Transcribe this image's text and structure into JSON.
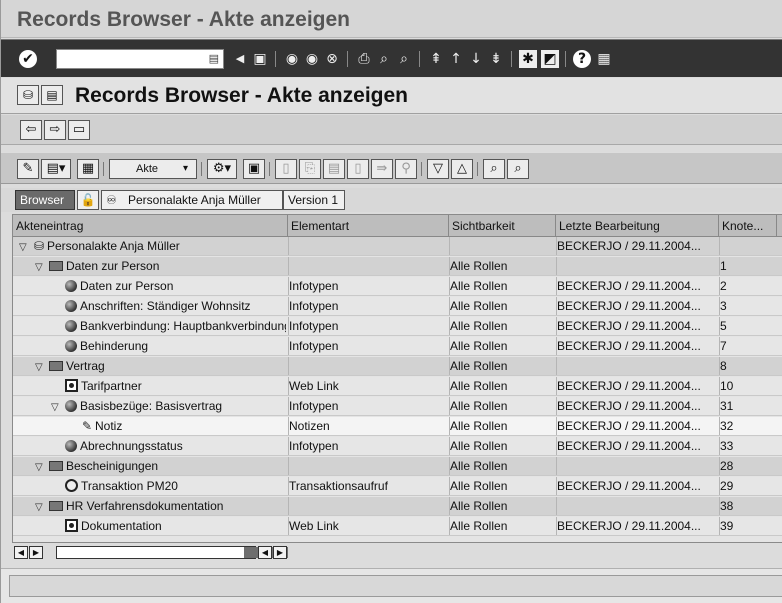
{
  "window": {
    "title": "Records Browser - Akte anzeigen"
  },
  "command_bar": {
    "command_field_value": "",
    "icons": [
      "enter-check",
      "save",
      "back",
      "exit",
      "cancel",
      "print",
      "find",
      "find-next",
      "first-page",
      "prev-page",
      "next-page",
      "last-page",
      "create-session",
      "generate-shortcut",
      "help",
      "layout-menu"
    ]
  },
  "header": {
    "title": "Records Browser - Akte anzeigen"
  },
  "nav_toolbar": {
    "icons": [
      "back-arrow",
      "forward-arrow",
      "overview"
    ]
  },
  "main_toolbar": {
    "akte_label": "Akte"
  },
  "breadcrumb": {
    "items": [
      "Browser",
      "Personalakte Anja Müller",
      "Version 1"
    ]
  },
  "table": {
    "columns": [
      "Akteneintrag",
      "Elementart",
      "Sichtbarkeit",
      "Letzte Bearbeitung",
      "Knote..."
    ],
    "rows": [
      {
        "name": "Personalakte Anja Müller",
        "type": "",
        "visibility": "",
        "last_edit": "BECKERJO / 29.11.2004...",
        "node": "",
        "level": 0,
        "expanded": true,
        "icon": "record",
        "kind": "folder"
      },
      {
        "name": "Daten zur Person",
        "type": "",
        "visibility": "Alle Rollen",
        "last_edit": "",
        "node": "1",
        "level": 1,
        "expanded": true,
        "icon": "folder",
        "kind": "folder"
      },
      {
        "name": "Daten zur Person",
        "type": "Infotypen",
        "visibility": "Alle Rollen",
        "last_edit": "BECKERJO / 29.11.2004...",
        "node": "2",
        "level": 2,
        "icon": "ball",
        "kind": "item"
      },
      {
        "name": "Anschriften: Ständiger Wohnsitz",
        "type": "Infotypen",
        "visibility": "Alle Rollen",
        "last_edit": "BECKERJO / 29.11.2004...",
        "node": "3",
        "level": 2,
        "icon": "ball",
        "kind": "item"
      },
      {
        "name": "Bankverbindung: Hauptbankverbindung",
        "type": "Infotypen",
        "visibility": "Alle Rollen",
        "last_edit": "BECKERJO / 29.11.2004...",
        "node": "5",
        "level": 2,
        "icon": "ball",
        "kind": "item"
      },
      {
        "name": "Behinderung",
        "type": "Infotypen",
        "visibility": "Alle Rollen",
        "last_edit": "BECKERJO / 29.11.2004...",
        "node": "7",
        "level": 2,
        "icon": "ball",
        "kind": "item"
      },
      {
        "name": "Vertrag",
        "type": "",
        "visibility": "Alle Rollen",
        "last_edit": "",
        "node": "8",
        "level": 1,
        "expanded": true,
        "icon": "folder",
        "kind": "folder"
      },
      {
        "name": "Tarifpartner",
        "type": "Web Link",
        "visibility": "Alle Rollen",
        "last_edit": "BECKERJO / 29.11.2004...",
        "node": "10",
        "level": 2,
        "icon": "weblink",
        "kind": "item"
      },
      {
        "name": "Basisbezüge: Basisvertrag",
        "type": "Infotypen",
        "visibility": "Alle Rollen",
        "last_edit": "BECKERJO / 29.11.2004...",
        "node": "31",
        "level": 2,
        "expanded": true,
        "icon": "ball",
        "kind": "item"
      },
      {
        "name": "Notiz",
        "type": "Notizen",
        "visibility": "Alle Rollen",
        "last_edit": "BECKERJO / 29.11.2004...",
        "node": "32",
        "level": 3,
        "icon": "note",
        "kind": "sel"
      },
      {
        "name": "Abrechnungsstatus",
        "type": "Infotypen",
        "visibility": "Alle Rollen",
        "last_edit": "BECKERJO / 29.11.2004...",
        "node": "33",
        "level": 2,
        "icon": "ball",
        "kind": "item"
      },
      {
        "name": "Bescheinigungen",
        "type": "",
        "visibility": "Alle Rollen",
        "last_edit": "",
        "node": "28",
        "level": 1,
        "expanded": true,
        "icon": "folder",
        "kind": "folder"
      },
      {
        "name": "Transaktion PM20",
        "type": "Transaktionsaufruf",
        "visibility": "Alle Rollen",
        "last_edit": "BECKERJO / 29.11.2004...",
        "node": "29",
        "level": 2,
        "icon": "transaction",
        "kind": "item"
      },
      {
        "name": "HR Verfahrensdokumentation",
        "type": "",
        "visibility": "Alle Rollen",
        "last_edit": "",
        "node": "38",
        "level": 1,
        "expanded": true,
        "icon": "folder",
        "kind": "folder"
      },
      {
        "name": "Dokumentation",
        "type": "Web Link",
        "visibility": "Alle Rollen",
        "last_edit": "BECKERJO / 29.11.2004...",
        "node": "39",
        "level": 2,
        "icon": "weblink",
        "kind": "item"
      }
    ]
  },
  "status_bar": {
    "message": ""
  }
}
